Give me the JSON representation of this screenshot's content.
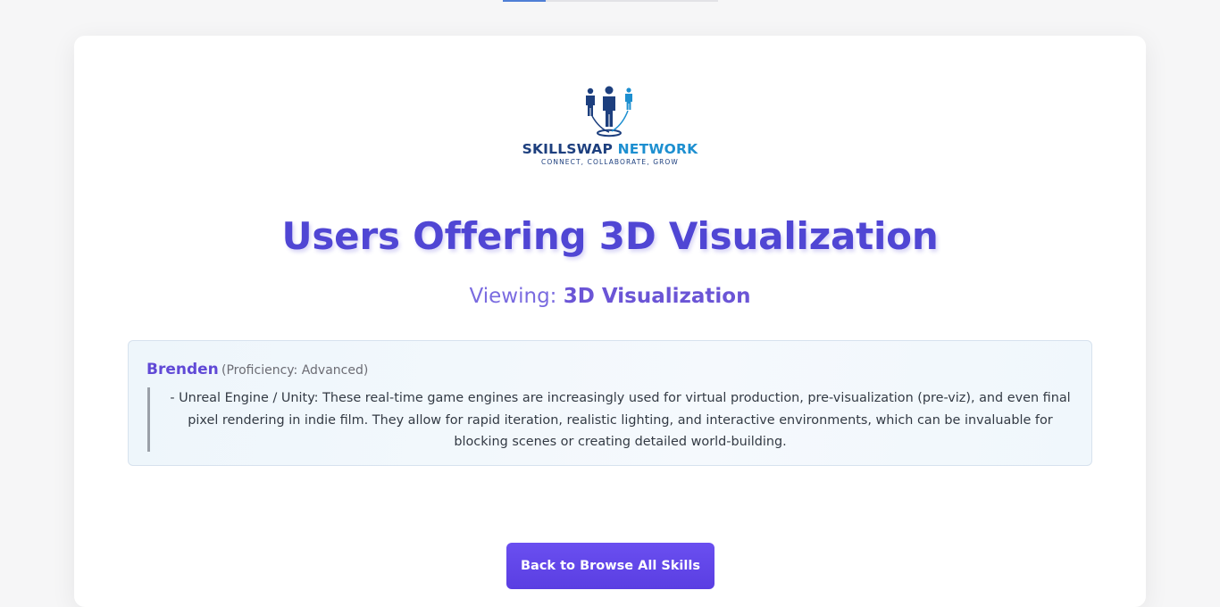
{
  "progress": 0.2,
  "logo": {
    "name_part1": "SKILLSWAP",
    "name_part2": "NETWORK",
    "tagline": "CONNECT, COLLABORATE, GROW"
  },
  "page": {
    "title": "Users Offering 3D Visualization",
    "viewing_prefix": "Viewing:",
    "viewing_skill": "3D Visualization"
  },
  "users": [
    {
      "name": "Brenden",
      "proficiency": "(Proficiency: Advanced)",
      "description": "- Unreal Engine / Unity: These real-time game engines are increasingly used for virtual production, pre-visualization (pre-viz), and even final pixel rendering in indie film. They allow for rapid iteration, realistic lighting, and interactive environments, which can be invaluable for blocking scenes or creating detailed world-building."
    }
  ],
  "actions": {
    "back_label": "Back to Browse All Skills"
  },
  "colors": {
    "accent": "#5046d4",
    "button": "#5a3ee2",
    "logo_dark": "#1d3f7e",
    "logo_light": "#1d8fd0"
  },
  "icons": {
    "logo_icon": "people-network-icon"
  }
}
